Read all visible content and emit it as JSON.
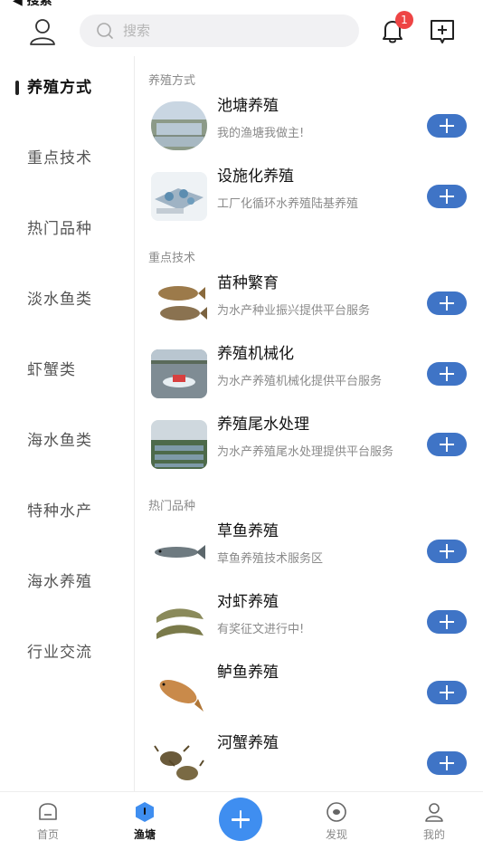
{
  "status": {
    "text": "◀ 搜索"
  },
  "header": {
    "search_placeholder": "搜索",
    "notification_count": "1"
  },
  "sidebar": {
    "items": [
      {
        "label": "养殖方式",
        "active": true
      },
      {
        "label": "重点技术",
        "active": false
      },
      {
        "label": "热门品种",
        "active": false
      },
      {
        "label": "淡水鱼类",
        "active": false
      },
      {
        "label": "虾蟹类",
        "active": false
      },
      {
        "label": "海水鱼类",
        "active": false
      },
      {
        "label": "特种水产",
        "active": false
      },
      {
        "label": "海水养殖",
        "active": false
      },
      {
        "label": "行业交流",
        "active": false
      }
    ]
  },
  "sections": [
    {
      "title": "养殖方式",
      "cards": [
        {
          "title": "池塘养殖",
          "subtitle": "我的渔塘我做主!",
          "image": "pond-photo"
        },
        {
          "title": "设施化养殖",
          "subtitle": "工厂化循环水养殖陆基养殖",
          "image": "facility-photo"
        }
      ]
    },
    {
      "title": "重点技术",
      "cards": [
        {
          "title": "苗种繁育",
          "subtitle": "为水产种业振兴提供平台服务",
          "image": "carp-photo"
        },
        {
          "title": "养殖机械化",
          "subtitle": "为水产养殖机械化提供平台服务",
          "image": "aerator-photo"
        },
        {
          "title": "养殖尾水处理",
          "subtitle": "为水产养殖尾水处理提供平台服务",
          "image": "wastewater-photo"
        }
      ]
    },
    {
      "title": "热门品种",
      "cards": [
        {
          "title": "草鱼养殖",
          "subtitle": "草鱼养殖技术服务区",
          "image": "grass-carp-photo"
        },
        {
          "title": "对虾养殖",
          "subtitle": "有奖征文进行中!",
          "image": "shrimp-photo"
        },
        {
          "title": "鲈鱼养殖",
          "subtitle": "",
          "image": "bass-photo"
        },
        {
          "title": "河蟹养殖",
          "subtitle": "",
          "image": "crab-photo"
        }
      ]
    }
  ],
  "tabbar": {
    "items": [
      {
        "label": "首页",
        "icon": "home-icon"
      },
      {
        "label": "渔塘",
        "icon": "pond-icon",
        "active": true
      },
      {
        "label": "",
        "icon": "plus-icon"
      },
      {
        "label": "发现",
        "icon": "discover-icon"
      },
      {
        "label": "我的",
        "icon": "profile-icon"
      }
    ]
  },
  "colors": {
    "accent": "#3f74c6",
    "fab": "#3f8ef0",
    "badge": "#ee4444"
  }
}
